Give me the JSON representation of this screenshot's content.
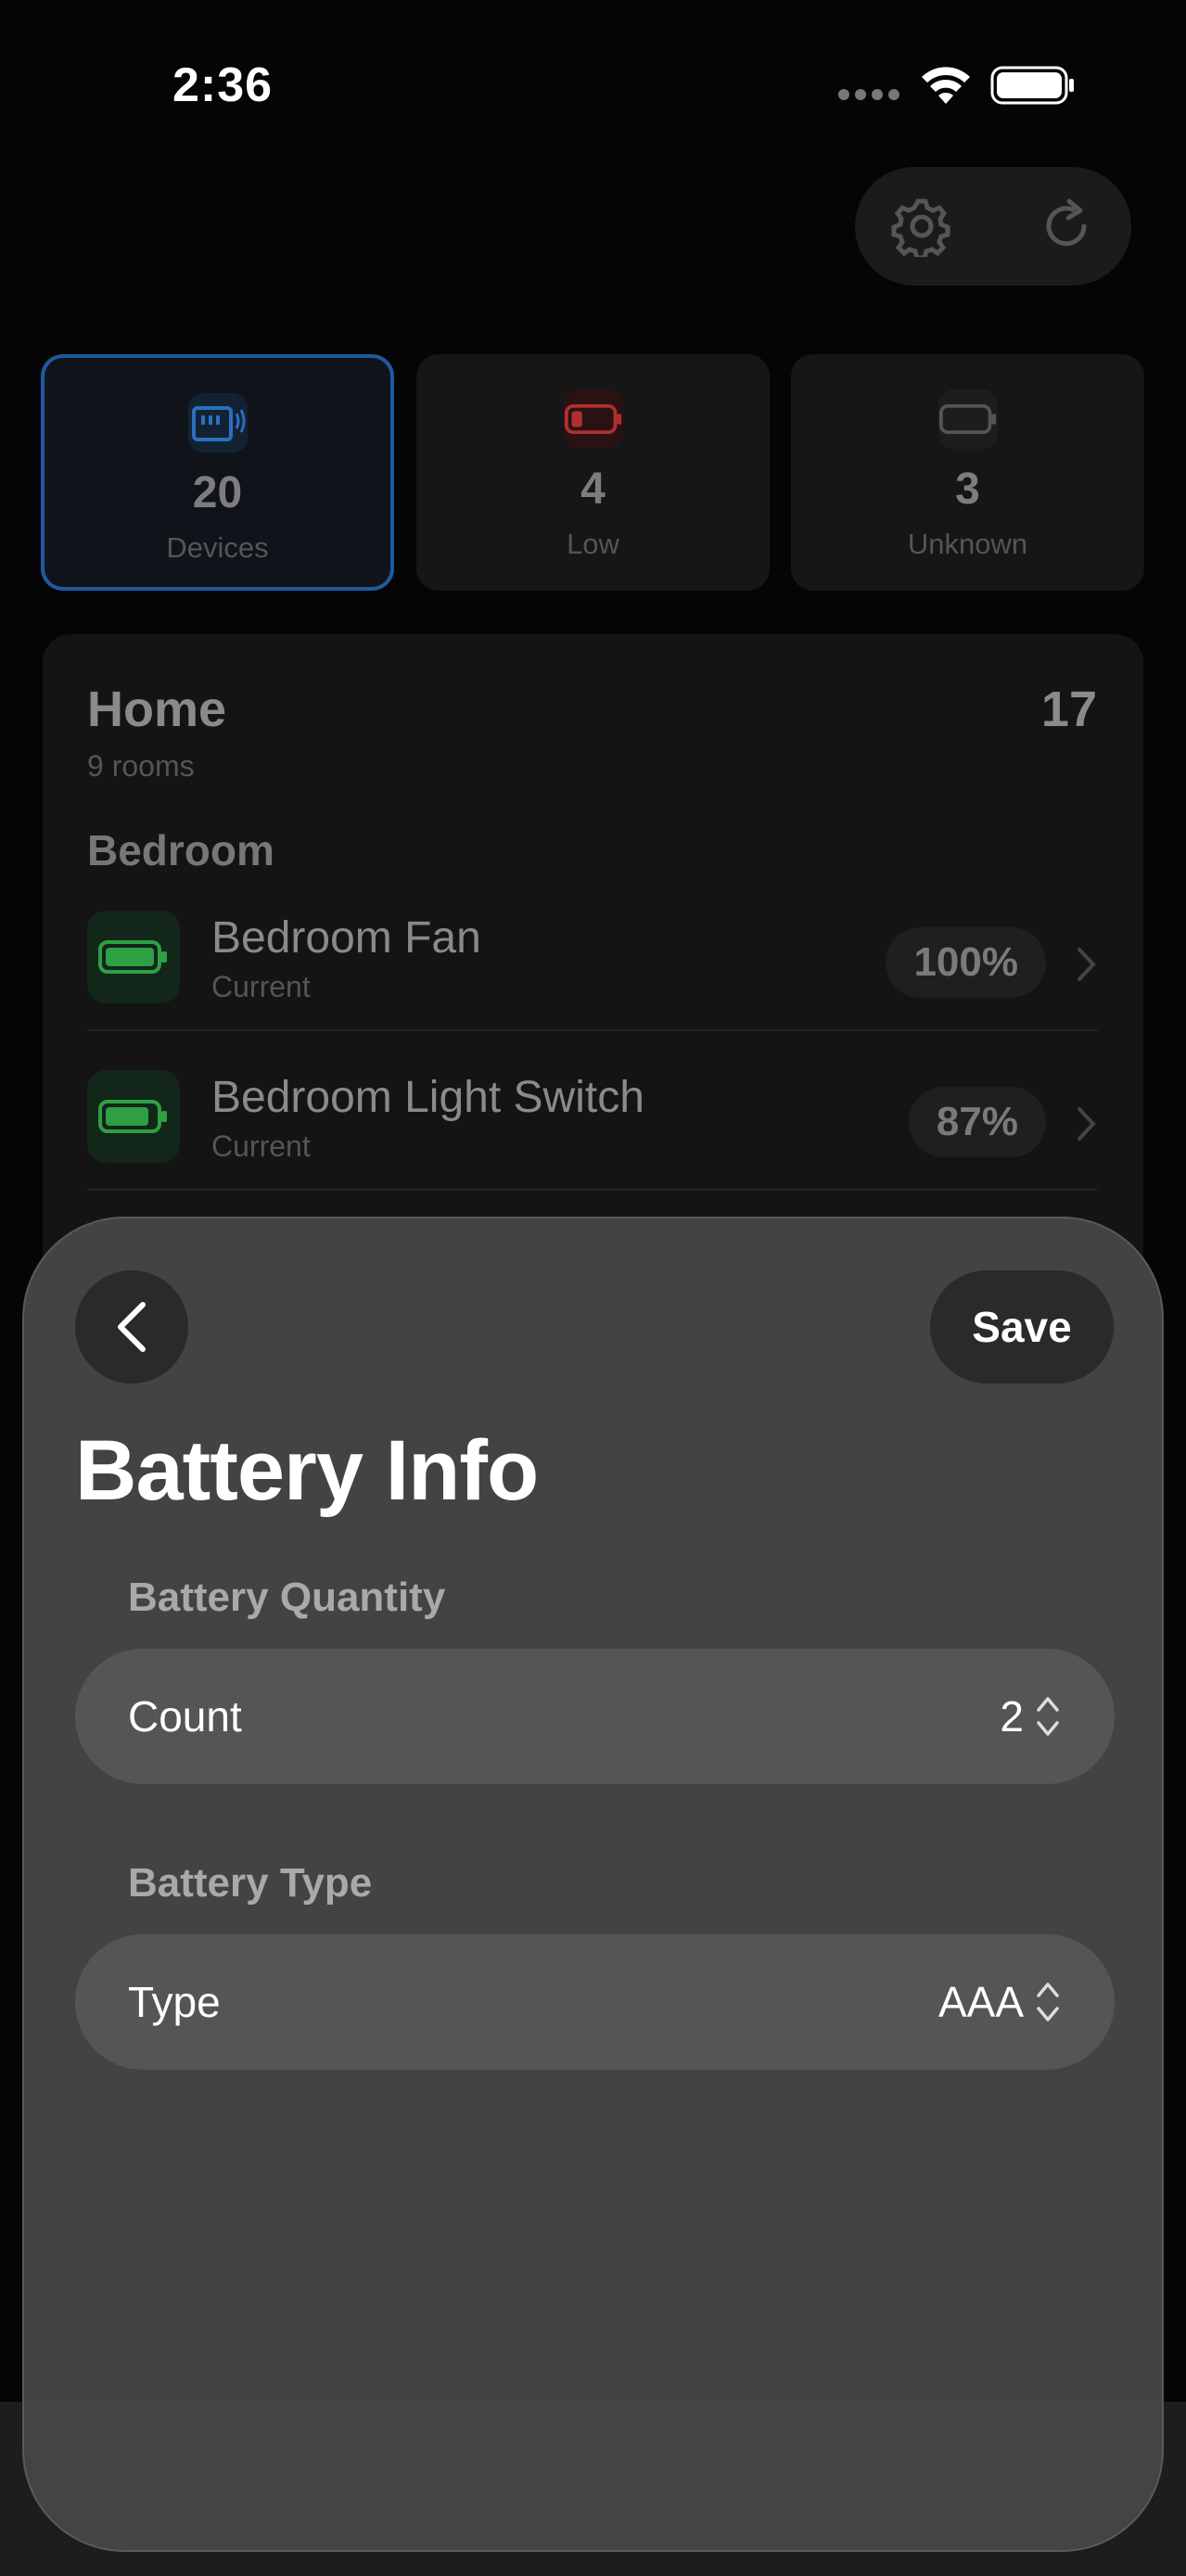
{
  "status_bar": {
    "time": "2:36"
  },
  "colors": {
    "accent_blue": "#1f5aa0",
    "battery_green": "#2ea043",
    "battery_red": "#c0392b",
    "sheet_bg": "#464646"
  },
  "toolbar": {
    "settings_icon": "gear-icon",
    "refresh_icon": "refresh-icon"
  },
  "stats": [
    {
      "value": "20",
      "label": "Devices",
      "icon": "devices-icon"
    },
    {
      "value": "4",
      "label": "Low",
      "icon": "low-battery-icon"
    },
    {
      "value": "3",
      "label": "Unknown",
      "icon": "unknown-battery-icon"
    }
  ],
  "home": {
    "title": "Home",
    "subtitle": "9 rooms",
    "count": "17",
    "room": "Bedroom",
    "devices": [
      {
        "name": "Bedroom Fan",
        "status": "Current",
        "percent": "100%"
      },
      {
        "name": "Bedroom Light Switch",
        "status": "Current",
        "percent": "87%"
      }
    ]
  },
  "sheet": {
    "title": "Battery Info",
    "save_label": "Save",
    "quantity_section": "Battery Quantity",
    "count_label": "Count",
    "count_value": "2",
    "type_section": "Battery Type",
    "type_label": "Type",
    "type_value": "AAA"
  }
}
